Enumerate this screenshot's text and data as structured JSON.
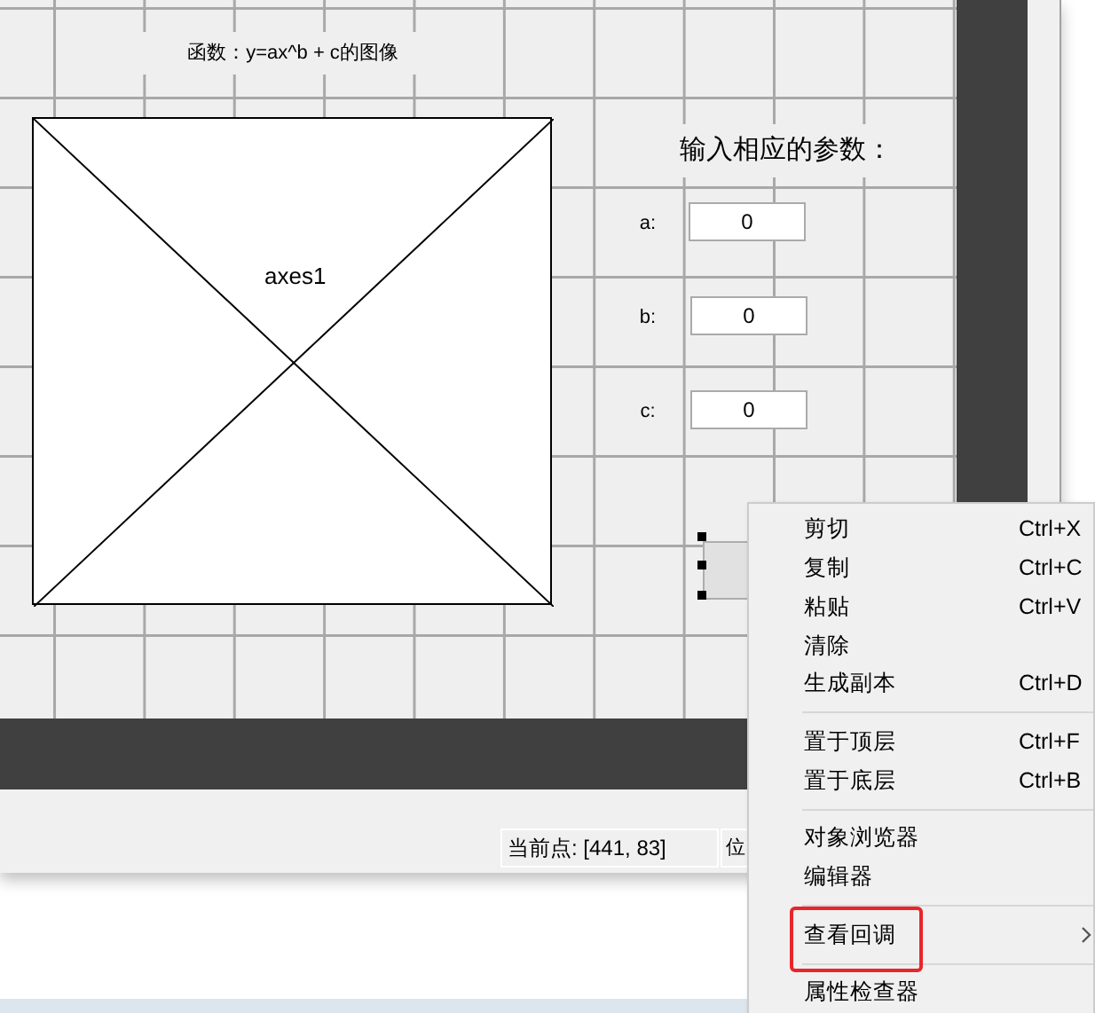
{
  "canvas": {
    "title_text": "函数：y=ax^b + c的图像",
    "axes": {
      "label": "axes1"
    },
    "prompt": "输入相应的参数：",
    "params": [
      {
        "label": "a:",
        "value": "0"
      },
      {
        "label": "b:",
        "value": "0"
      },
      {
        "label": "c:",
        "value": "0"
      }
    ],
    "push_button": {
      "selected": true
    }
  },
  "status_bar": {
    "fields": [
      "当前点:  [441, 83]",
      "位"
    ]
  },
  "context_menu": {
    "items": [
      {
        "kind": "item",
        "label": "剪切",
        "shortcut": "Ctrl+X",
        "submenu": false,
        "highlighted": false
      },
      {
        "kind": "item",
        "label": "复制",
        "shortcut": "Ctrl+C",
        "submenu": false,
        "highlighted": false
      },
      {
        "kind": "item",
        "label": "粘贴",
        "shortcut": "Ctrl+V",
        "submenu": false,
        "highlighted": false
      },
      {
        "kind": "item",
        "label": "清除",
        "submenu": false,
        "highlighted": false
      },
      {
        "kind": "item",
        "label": "生成副本",
        "shortcut": "Ctrl+D",
        "submenu": false,
        "highlighted": false
      },
      {
        "kind": "separator"
      },
      {
        "kind": "item",
        "label": "置于顶层",
        "shortcut": "Ctrl+F",
        "submenu": false,
        "highlighted": false
      },
      {
        "kind": "item",
        "label": "置于底层",
        "shortcut": "Ctrl+B",
        "submenu": false,
        "highlighted": false
      },
      {
        "kind": "separator"
      },
      {
        "kind": "item",
        "label": "对象浏览器",
        "submenu": false,
        "highlighted": false
      },
      {
        "kind": "item",
        "label": "编辑器",
        "submenu": false,
        "highlighted": false
      },
      {
        "kind": "separator"
      },
      {
        "kind": "item",
        "label": "查看回调",
        "submenu": true,
        "highlighted": true
      },
      {
        "kind": "separator"
      },
      {
        "kind": "item",
        "label": "属性检查器",
        "submenu": false,
        "highlighted": false
      }
    ]
  }
}
